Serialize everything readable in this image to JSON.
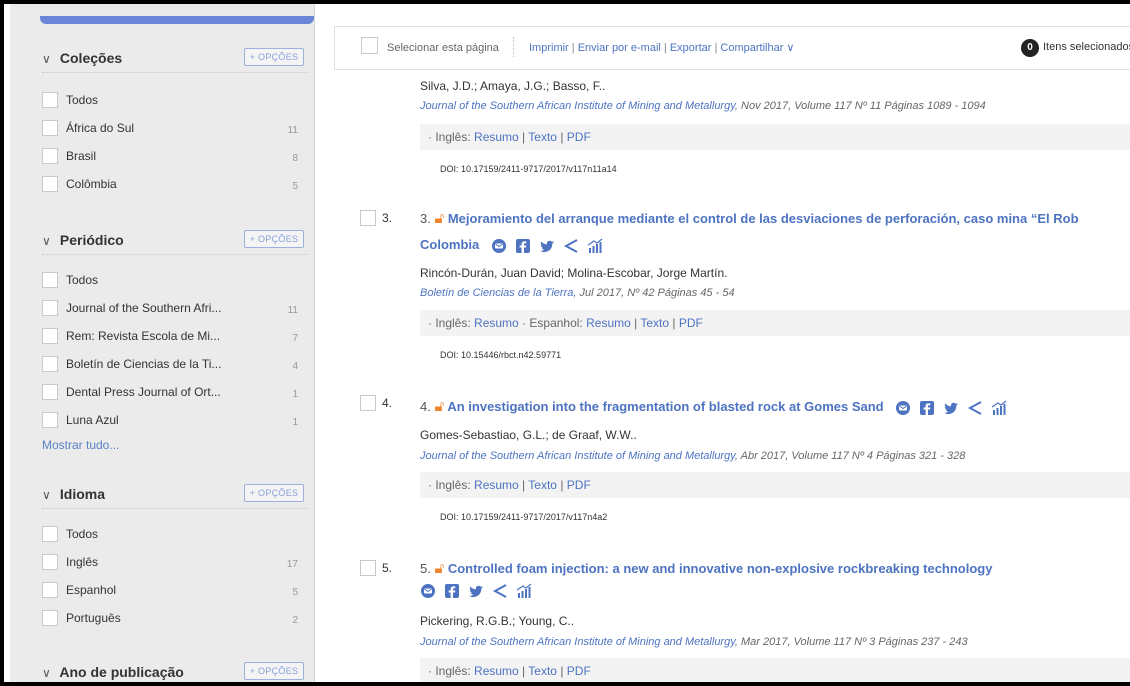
{
  "sidebar": {
    "colecoes": {
      "title": "Coleções",
      "opcoes": "+ OPÇÕES",
      "items": [
        {
          "label": "Todos",
          "count": ""
        },
        {
          "label": "África do Sul",
          "count": "11"
        },
        {
          "label": "Brasil",
          "count": "8"
        },
        {
          "label": "Colômbia",
          "count": "5"
        }
      ]
    },
    "periodico": {
      "title": "Periódico",
      "opcoes": "+ OPÇÕES",
      "items": [
        {
          "label": "Todos",
          "count": ""
        },
        {
          "label": "Journal of the Southern Afri...",
          "count": "11"
        },
        {
          "label": "Rem: Revista Escola de Mi...",
          "count": "7"
        },
        {
          "label": "Boletín de Ciencias de la Ti...",
          "count": "4"
        },
        {
          "label": "Dental Press Journal of Ort...",
          "count": "1"
        },
        {
          "label": "Luna Azul",
          "count": "1"
        }
      ],
      "mostrar": "Mostrar tudo..."
    },
    "idioma": {
      "title": "Idioma",
      "opcoes": "+ OPÇÕES",
      "items": [
        {
          "label": "Todos",
          "count": ""
        },
        {
          "label": "Inglês",
          "count": "17"
        },
        {
          "label": "Espanhol",
          "count": "5"
        },
        {
          "label": "Português",
          "count": "2"
        }
      ]
    },
    "ano": {
      "title": "Ano de publicação",
      "opcoes": "+ OPÇÕES"
    }
  },
  "toolbar": {
    "select_page": "Selecionar esta página",
    "imprimir": "Imprimir",
    "email": "Enviar por e-mail",
    "exportar": "Exportar",
    "compartilhar": "Compartilhar",
    "selected_count": "0",
    "selected_label": "Itens selecionados"
  },
  "records": [
    {
      "authors": "Silva, J.D.; Amaya, J.G.; Basso, F..",
      "journal": "Journal of the Southern African Institute of Mining and Metallurgy,",
      "meta": "Nov 2017, Volume 117    Nº 11    Páginas 1089 - 1094",
      "lang_prefix": "· Inglês:",
      "links": [
        "Resumo",
        "Texto",
        "PDF"
      ],
      "doi": "DOI: 10.17159/2411-9717/2017/v117n11a14"
    },
    {
      "num": "3.",
      "title_num": "3.",
      "title": "Mejoramiento del arranque mediante el control de las desviaciones de perforación, caso mina “El Rob",
      "title_cont": "Colombia",
      "authors": "Rincón-Durán, Juan David; Molina-Escobar, Jorge Martín.",
      "journal": "Boletín de Ciencias de la Tierra,",
      "meta": "Jul 2017, Nº 42    Páginas 45 - 54",
      "lang_prefix": "· Inglês:",
      "lang2": "· Espanhol:",
      "links": [
        "Resumo",
        "Resumo",
        "Texto",
        "PDF"
      ],
      "doi": "DOI: 10.15446/rbct.n42.59771"
    },
    {
      "num": "4.",
      "title_num": "4.",
      "title": "An investigation into the fragmentation of blasted rock at Gomes Sand",
      "authors": "Gomes-Sebastiao, G.L.; de Graaf, W.W..",
      "journal": "Journal of the Southern African Institute of Mining and Metallurgy,",
      "meta": "Abr 2017, Volume 117    Nº 4    Páginas 321 - 328",
      "lang_prefix": "· Inglês:",
      "links": [
        "Resumo",
        "Texto",
        "PDF"
      ],
      "doi": "DOI: 10.17159/2411-9717/2017/v117n4a2"
    },
    {
      "num": "5.",
      "title_num": "5.",
      "title": "Controlled foam injection: a new and innovative non-explosive rockbreaking technology",
      "authors": "Pickering, R.G.B.; Young, C..",
      "journal": "Journal of the Southern African Institute of Mining and Metallurgy,",
      "meta": "Mar 2017, Volume 117    Nº 3    Páginas 237 - 243",
      "lang_prefix": "· Inglês:",
      "links": [
        "Resumo",
        "Texto",
        "PDF"
      ]
    }
  ],
  "colors": {
    "link": "#4d73c1",
    "lock": "#f0842c",
    "sidebar_bg": "#ebebeb"
  }
}
